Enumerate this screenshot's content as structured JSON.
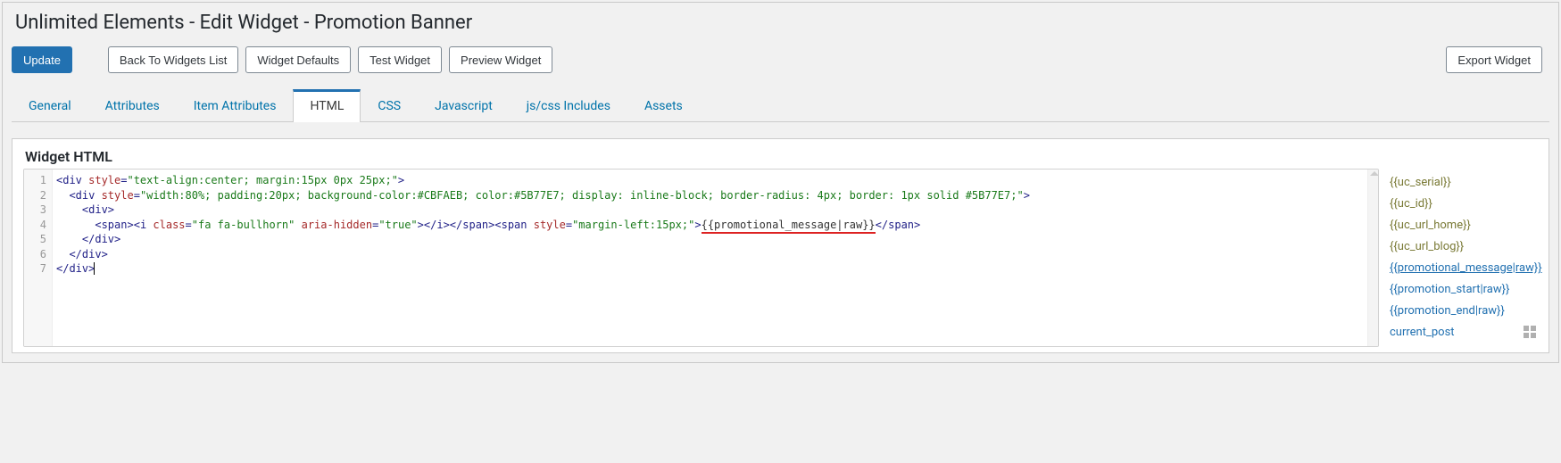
{
  "page_title": "Unlimited Elements - Edit Widget - Promotion Banner",
  "toolbar": {
    "update": "Update",
    "back": "Back To Widgets List",
    "defaults": "Widget Defaults",
    "test": "Test Widget",
    "preview": "Preview Widget",
    "export": "Export Widget"
  },
  "tabs": {
    "general": "General",
    "attributes": "Attributes",
    "item_attributes": "Item Attributes",
    "html": "HTML",
    "css": "CSS",
    "javascript": "Javascript",
    "jscss": "js/css Includes",
    "assets": "Assets",
    "active": "html"
  },
  "panel_title": "Widget HTML",
  "code": {
    "line_count": 7,
    "l1": {
      "open": "<div ",
      "attr": "style",
      "val": "\"text-align:center; margin:15px 0px 25px;\"",
      "close": ">"
    },
    "l2": {
      "indent": "  ",
      "open": "<div ",
      "attr": "style",
      "val": "\"width:80%; padding:20px; background-color:#CBFAEB; color:#5B77E7; display: inline-block; border-radius: 4px; border: 1px solid #5B77E7;\"",
      "close": ">"
    },
    "l3": {
      "indent": "    ",
      "tag": "<div>"
    },
    "l4": {
      "indent": "      ",
      "span_open": "<span>",
      "i_open": "<i ",
      "class_attr": "class",
      "class_val": "\"fa fa-bullhorn\"",
      "aria_attr": "aria-hidden",
      "aria_val": "\"true\"",
      "i_close_open": "></i></span><span ",
      "style_attr": "style",
      "style_val": "\"margin-left:15px;\"",
      "mid_close": ">",
      "template": "{{promotional_message|raw}}",
      "span_close": "</span>"
    },
    "l5": {
      "indent": "    ",
      "tag": "</div>"
    },
    "l6": {
      "indent": "  ",
      "tag": "</div>"
    },
    "l7": {
      "indent": "",
      "tag": "</div>"
    }
  },
  "sidebar": {
    "items": [
      {
        "text": "{{uc_serial}}",
        "cls": "st"
      },
      {
        "text": "{{uc_id}}",
        "cls": "st"
      },
      {
        "text": "{{uc_url_home}}",
        "cls": "st"
      },
      {
        "text": "{{uc_url_blog}}",
        "cls": "st"
      },
      {
        "text": "{{promotional_message|raw}}",
        "cls": "sel"
      },
      {
        "text": "{{promotion_start|raw}}",
        "cls": "lk"
      },
      {
        "text": "{{promotion_end|raw}}",
        "cls": "lk"
      },
      {
        "text": "current_post",
        "cls": "lk"
      }
    ]
  }
}
